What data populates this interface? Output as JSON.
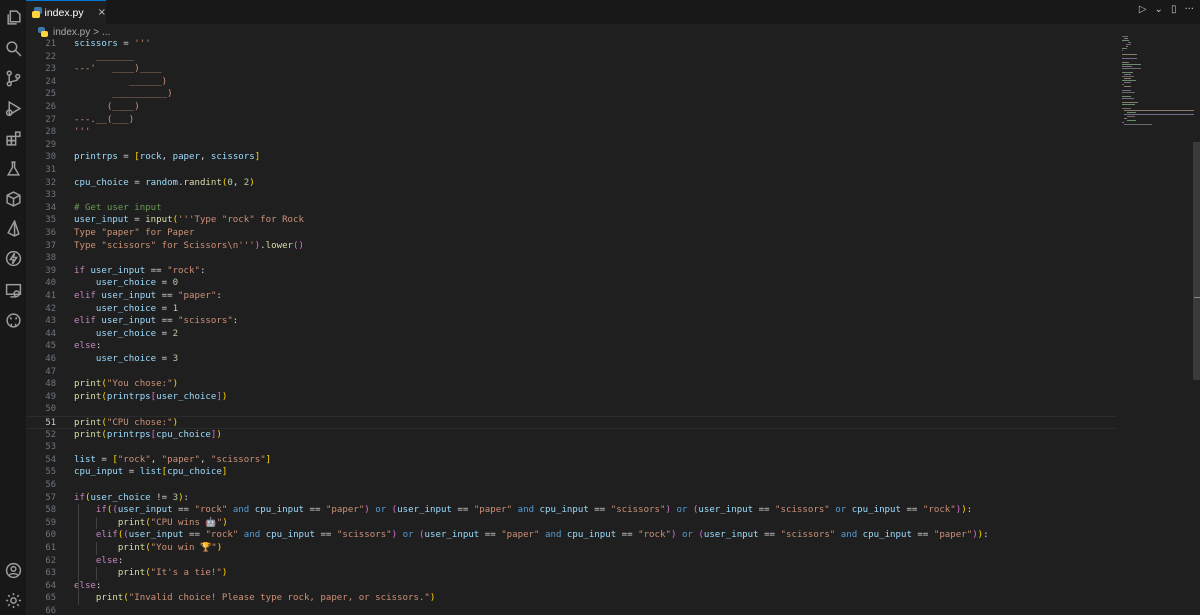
{
  "tab": {
    "label": "index.py",
    "close": "×"
  },
  "breadcrumb": {
    "file": "index.py",
    "sep": ">",
    "more": "..."
  },
  "editor_actions": {
    "run": "▷",
    "chevron": "⌄",
    "split": "▯",
    "more": "···"
  },
  "activity_icons": [
    "explorer-icon",
    "search-icon",
    "source-control-icon",
    "run-debug-icon",
    "extensions-icon",
    "testing-icon",
    "package-icon",
    "prisma-icon",
    "lightning-icon",
    "remote-explorer-icon",
    "github-icon",
    "account-icon",
    "settings-gear-icon"
  ],
  "active_line": "51",
  "lines": [
    {
      "n": "21",
      "t": "scissors = '''"
    },
    {
      "n": "22",
      "t": "    _______"
    },
    {
      "n": "23",
      "t": "---'   ____)____"
    },
    {
      "n": "24",
      "t": "          ______)"
    },
    {
      "n": "25",
      "t": "       __________)"
    },
    {
      "n": "26",
      "t": "      (____)"
    },
    {
      "n": "27",
      "t": "---.__(___)"
    },
    {
      "n": "28",
      "t": "'''"
    },
    {
      "n": "29",
      "t": ""
    },
    {
      "n": "30",
      "t": "printrps = [rock, paper, scissors]"
    },
    {
      "n": "31",
      "t": ""
    },
    {
      "n": "32",
      "t": "cpu_choice = random.randint(0, 2)"
    },
    {
      "n": "33",
      "t": ""
    },
    {
      "n": "34",
      "t": "# Get user input"
    },
    {
      "n": "35",
      "t": "user_input = input('''Type \"rock\" for Rock"
    },
    {
      "n": "36",
      "t": "Type \"paper\" for Paper"
    },
    {
      "n": "37",
      "t": "Type \"scissors\" for Scissors\\n''').lower()"
    },
    {
      "n": "38",
      "t": ""
    },
    {
      "n": "39",
      "t": "if user_input == \"rock\":"
    },
    {
      "n": "40",
      "t": "    user_choice = 0"
    },
    {
      "n": "41",
      "t": "elif user_input == \"paper\":"
    },
    {
      "n": "42",
      "t": "    user_choice = 1"
    },
    {
      "n": "43",
      "t": "elif user_input == \"scissors\":"
    },
    {
      "n": "44",
      "t": "    user_choice = 2"
    },
    {
      "n": "45",
      "t": "else:"
    },
    {
      "n": "46",
      "t": "    user_choice = 3"
    },
    {
      "n": "47",
      "t": ""
    },
    {
      "n": "48",
      "t": "print(\"You chose:\")"
    },
    {
      "n": "49",
      "t": "print(printrps[user_choice])"
    },
    {
      "n": "50",
      "t": ""
    },
    {
      "n": "51",
      "t": "print(\"CPU chose:\")"
    },
    {
      "n": "52",
      "t": "print(printrps[cpu_choice])"
    },
    {
      "n": "53",
      "t": ""
    },
    {
      "n": "54",
      "t": "list = [\"rock\", \"paper\", \"scissors\"]"
    },
    {
      "n": "55",
      "t": "cpu_input = list[cpu_choice]"
    },
    {
      "n": "56",
      "t": ""
    },
    {
      "n": "57",
      "t": "if(user_choice != 3):"
    },
    {
      "n": "58",
      "t": "    if((user_input == \"rock\" and cpu_input == \"paper\") or (user_input == \"paper\" and cpu_input == \"scissors\") or (user_input == \"scissors\" or cpu_input == \"rock\")):"
    },
    {
      "n": "59",
      "t": "        print(\"CPU wins 🤖\")"
    },
    {
      "n": "60",
      "t": "    elif((user_input == \"rock\" and cpu_input == \"scissors\") or (user_input == \"paper\" and cpu_input == \"rock\") or (user_input == \"scissors\" and cpu_input == \"paper\")):"
    },
    {
      "n": "61",
      "t": "        print(\"You win 🏆\")"
    },
    {
      "n": "62",
      "t": "    else:"
    },
    {
      "n": "63",
      "t": "        print(\"It's a tie!\")"
    },
    {
      "n": "64",
      "t": "else:"
    },
    {
      "n": "65",
      "t": "    print(\"Invalid choice! Please type rock, paper, or scissors.\")"
    },
    {
      "n": "66",
      "t": ""
    }
  ],
  "colors": {
    "editor_bg": "#1f1f1f",
    "sidebar_bg": "#181818",
    "keyword": "#c586c0",
    "string": "#ce9178",
    "comment": "#6a9955",
    "number": "#b5cea8",
    "function": "#dcdcaa",
    "variable": "#9cdcfe",
    "accent": "#0078d4"
  }
}
